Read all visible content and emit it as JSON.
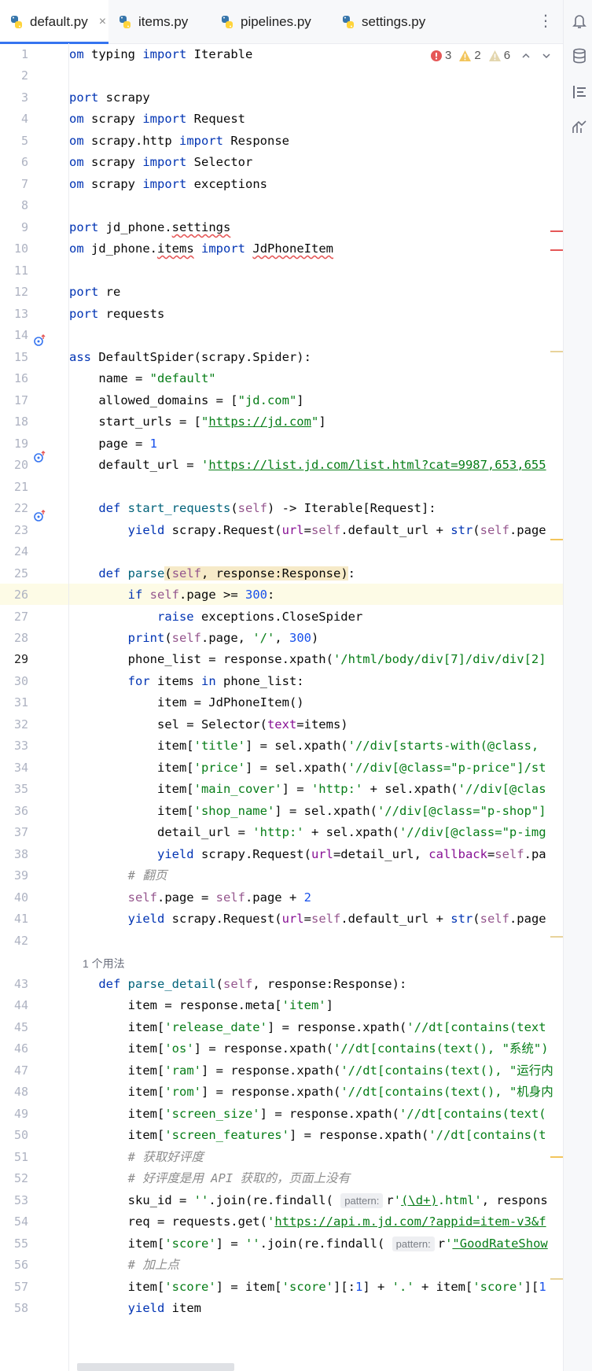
{
  "tabs": [
    {
      "label": "default.py",
      "active": true
    },
    {
      "label": "items.py",
      "active": false
    },
    {
      "label": "pipelines.py",
      "active": false
    },
    {
      "label": "settings.py",
      "active": false
    }
  ],
  "tab_close_glyph": "×",
  "kebab_glyph": "⋮",
  "right_toolbar_icons": [
    "notifications-icon",
    "database-icon",
    "structure-icon",
    "analysis-icon"
  ],
  "inspections": {
    "errors": "3",
    "warnings": "2",
    "weak_warnings": "6"
  },
  "usage_hint": "1 个用法",
  "param_hint": "pattern:",
  "line_numbers": [
    "1",
    "2",
    "3",
    "4",
    "5",
    "6",
    "7",
    "8",
    "9",
    "10",
    "11",
    "12",
    "13",
    "14",
    "15",
    "16",
    "17",
    "18",
    "19",
    "20",
    "21",
    "22",
    "23",
    "24",
    "25",
    "26",
    "27",
    "28",
    "29",
    "30",
    "31",
    "32",
    "33",
    "34",
    "35",
    "36",
    "37",
    "38",
    "39",
    "40",
    "41",
    "42",
    "43",
    "44",
    "45",
    "46",
    "47",
    "48",
    "49",
    "50",
    "51",
    "52",
    "53",
    "54",
    "55",
    "56",
    "57",
    "58"
  ],
  "current_line": "29",
  "code": {
    "l1": "om typing import Iterable",
    "l3": "port scrapy",
    "l4": "om scrapy import Request",
    "l5": "om scrapy.http import Response",
    "l6": "om scrapy import Selector",
    "l7": "om scrapy import exceptions",
    "l9": "port jd_phone.settings",
    "l10": "om jd_phone.items import JdPhoneItem",
    "l12": "port re",
    "l13": "port requests",
    "l15": "ass DefaultSpider(scrapy.Spider):",
    "l16": "    name = \"default\"",
    "l17": "    allowed_domains = [\"jd.com\"]",
    "l18": "    start_urls = [\"https://jd.com\"]",
    "l19": "    page = 1",
    "l20": "    default_url = 'https://list.jd.com/list.html?cat=9987,653,655",
    "l22": "    def start_requests(self) -> Iterable[Request]:",
    "l23": "        yield scrapy.Request(url=self.default_url + str(self.page",
    "l25": "    def parse(self, response:Response):",
    "l26": "        if self.page >= 300:",
    "l27": "            raise exceptions.CloseSpider",
    "l28": "        print(self.page, '/', 300)",
    "l29": "        phone_list = response.xpath('/html/body/div[7]/div/div[2]",
    "l30": "        for items in phone_list:",
    "l31": "            item = JdPhoneItem()",
    "l32": "            sel = Selector(text=items)",
    "l33": "            item['title'] = sel.xpath('//div[starts-with(@class,",
    "l34": "            item['price'] = sel.xpath('//div[@class=\"p-price\"]/st",
    "l35": "            item['main_cover'] = 'http:' + sel.xpath('//div[@clas",
    "l36": "            item['shop_name'] = sel.xpath('//div[@class=\"p-shop\"]",
    "l37": "            detail_url = 'http:' + sel.xpath('//div[@class=\"p-img",
    "l38": "            yield scrapy.Request(url=detail_url, callback=self.pa",
    "l39": "        # 翻页",
    "l40": "        self.page = self.page + 2",
    "l41": "        yield scrapy.Request(url=self.default_url + str(self.page",
    "l43": "    def parse_detail(self, response:Response):",
    "l44": "        item = response.meta['item']",
    "l45": "        item['release_date'] = response.xpath('//dt[contains(text",
    "l46": "        item['os'] = response.xpath('//dt[contains(text(), \"系统\")",
    "l47": "        item['ram'] = response.xpath('//dt[contains(text(), \"运行内",
    "l48": "        item['rom'] = response.xpath('//dt[contains(text(), \"机身内",
    "l49": "        item['screen_size'] = response.xpath('//dt[contains(text(",
    "l50": "        item['screen_features'] = response.xpath('//dt[contains(t",
    "l51": "        # 获取好评度",
    "l52": "        # 好评度是用 API 获取的，页面上没有",
    "l53": "        sku_id = ''.join(re.findall( pattern: r'(\\d+).html', respons",
    "l54": "        req = requests.get('https://api.m.jd.com/?appid=item-v3&f",
    "l55": "        item['score'] = ''.join(re.findall( pattern: r'\"GoodRateShow",
    "l56": "        # 加上点",
    "l57": "        item['score'] = item['score'][:1] + '.' + item['score'][1",
    "l58": "        yield item"
  }
}
